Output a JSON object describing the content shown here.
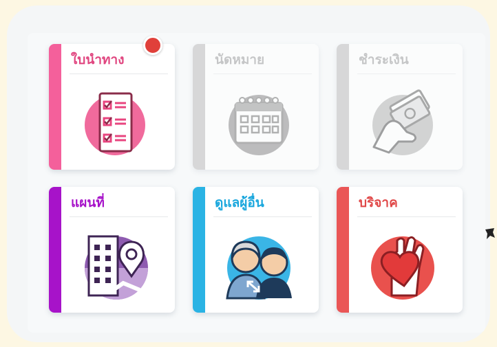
{
  "menu": {
    "tiles": [
      {
        "label": "ใบนำทาง",
        "color": "#f4609b",
        "icon": "checklist-icon",
        "enabled": true,
        "has_notification": true
      },
      {
        "label": "นัดหมาย",
        "color": "#bdbdbd",
        "icon": "calendar-icon",
        "enabled": false
      },
      {
        "label": "ชำระเงิน",
        "color": "#bdbdbd",
        "icon": "payment-icon",
        "enabled": false
      },
      {
        "label": "แผนที่",
        "color": "#a713c9",
        "icon": "map-building-icon",
        "enabled": true
      },
      {
        "label": "ดูแลผู้อื่น",
        "color": "#2ab3e4",
        "icon": "caregivers-icon",
        "enabled": true
      },
      {
        "label": "บริจาค",
        "color": "#ea5656",
        "icon": "donate-heart-icon",
        "enabled": true
      }
    ]
  },
  "colors": {
    "background": "#fdf7e3",
    "panel": "#f4f6f7",
    "notification": "#e0403a"
  }
}
